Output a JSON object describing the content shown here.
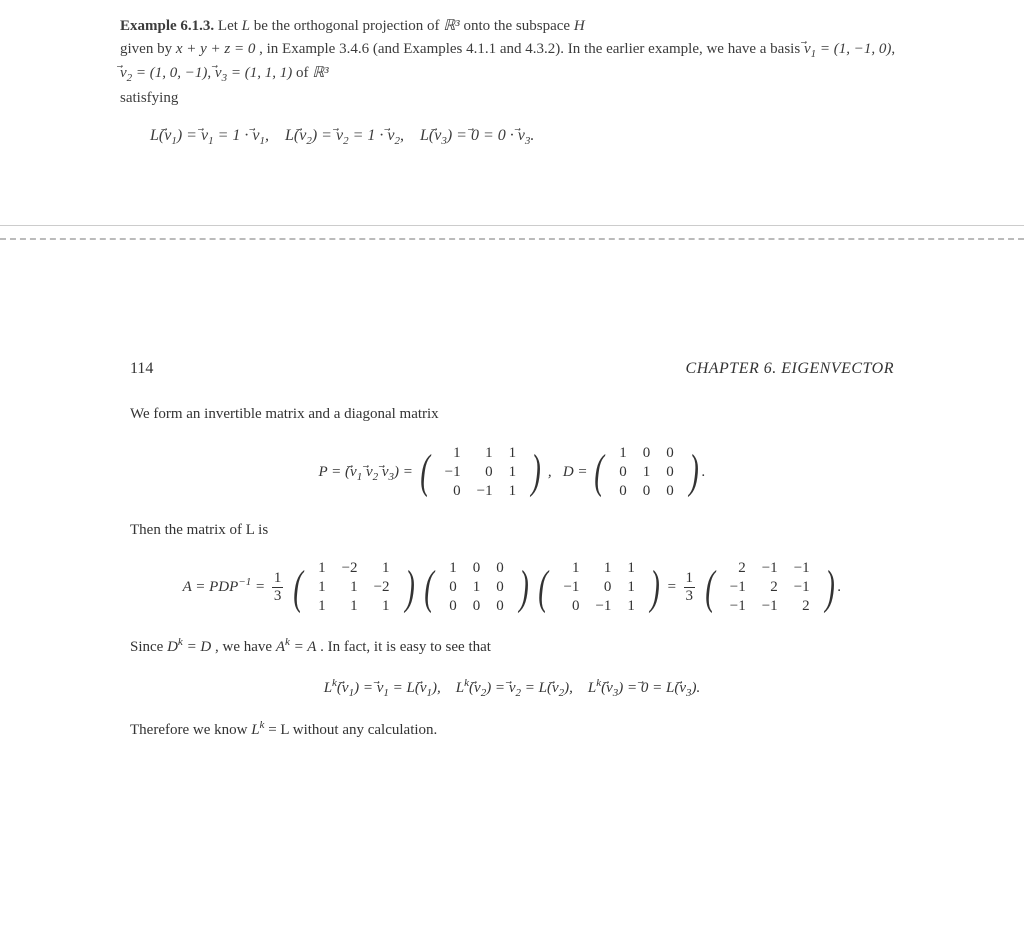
{
  "upper": {
    "example_label": "Example 6.1.3.",
    "para1a": "Let ",
    "para1b": " be the orthogonal projection of ",
    "para1c": " onto the subspace ",
    "para1d": "given by ",
    "eq_plane": "x + y + z = 0",
    "para1e": ", in Example 3.4.6 (and Examples 4.1.1 and 4.3.2). In the earlier example, we have a basis ",
    "v1": "(1, −1, 0)",
    "v2": "(1, 0, −1)",
    "v3": "(1, 1, 1)",
    "para1f": " of ",
    "satisfying": "satisfying",
    "eq_L_text": "L(v⃗₁) = v⃗₁ = 1 · v⃗₁,    L(v⃗₂) = v⃗₂ = 1 · v⃗₂,    L(v⃗₃) = 0⃗ = 0 · v⃗₃."
  },
  "lower": {
    "page_no": "114",
    "chapter": "CHAPTER 6.  EIGENVECTOR",
    "line1": "We form an invertible matrix and a diagonal matrix",
    "P_def_lhs": "P = (v⃗₁ v⃗₂ v⃗₃) =",
    "P": {
      "r1": [
        "1",
        "1",
        "1"
      ],
      "r2": [
        "−1",
        "0",
        "1"
      ],
      "r3": [
        "0",
        "−1",
        "1"
      ]
    },
    "D_lhs": ",    D =",
    "D": {
      "r1": [
        "1",
        "0",
        "0"
      ],
      "r2": [
        "0",
        "1",
        "0"
      ],
      "r3": [
        "0",
        "0",
        "0"
      ]
    },
    "then": "Then the matrix of L is",
    "A_lhs": "A = PDP",
    "A_exp": "−1",
    "A_eq": " = ",
    "frac_num": "1",
    "frac_den": "3",
    "P_inv": {
      "r1": [
        "1",
        "−2",
        "1"
      ],
      "r2": [
        "1",
        "1",
        "−2"
      ],
      "r3": [
        "1",
        "1",
        "1"
      ]
    },
    "D2": {
      "r1": [
        "1",
        "0",
        "0"
      ],
      "r2": [
        "0",
        "1",
        "0"
      ],
      "r3": [
        "0",
        "0",
        "0"
      ]
    },
    "P2": {
      "r1": [
        "1",
        "1",
        "1"
      ],
      "r2": [
        "−1",
        "0",
        "1"
      ],
      "r3": [
        "0",
        "−1",
        "1"
      ]
    },
    "A_res": {
      "r1": [
        "2",
        "−1",
        "−1"
      ],
      "r2": [
        "−1",
        "2",
        "−1"
      ],
      "r3": [
        "−1",
        "−1",
        "2"
      ]
    },
    "since_a": "Since ",
    "since_b": ", we have ",
    "since_c": ". In fact, it is easy to see that",
    "eq_Lk": "Lᵏ(v⃗₁) = v⃗₁ = L(v⃗₁),    Lᵏ(v⃗₂) = v⃗₂ = L(v⃗₂),    Lᵏ(v⃗₃) = 0⃗ = L(v⃗₃).",
    "therefore_a": "Therefore we know ",
    "therefore_b": " = L without any calculation."
  },
  "R3_html": "ℝ³",
  "Dk_eq_D": "Dᵏ = D",
  "Ak_eq_A": "Aᵏ = A",
  "Lk": "Lᵏ"
}
